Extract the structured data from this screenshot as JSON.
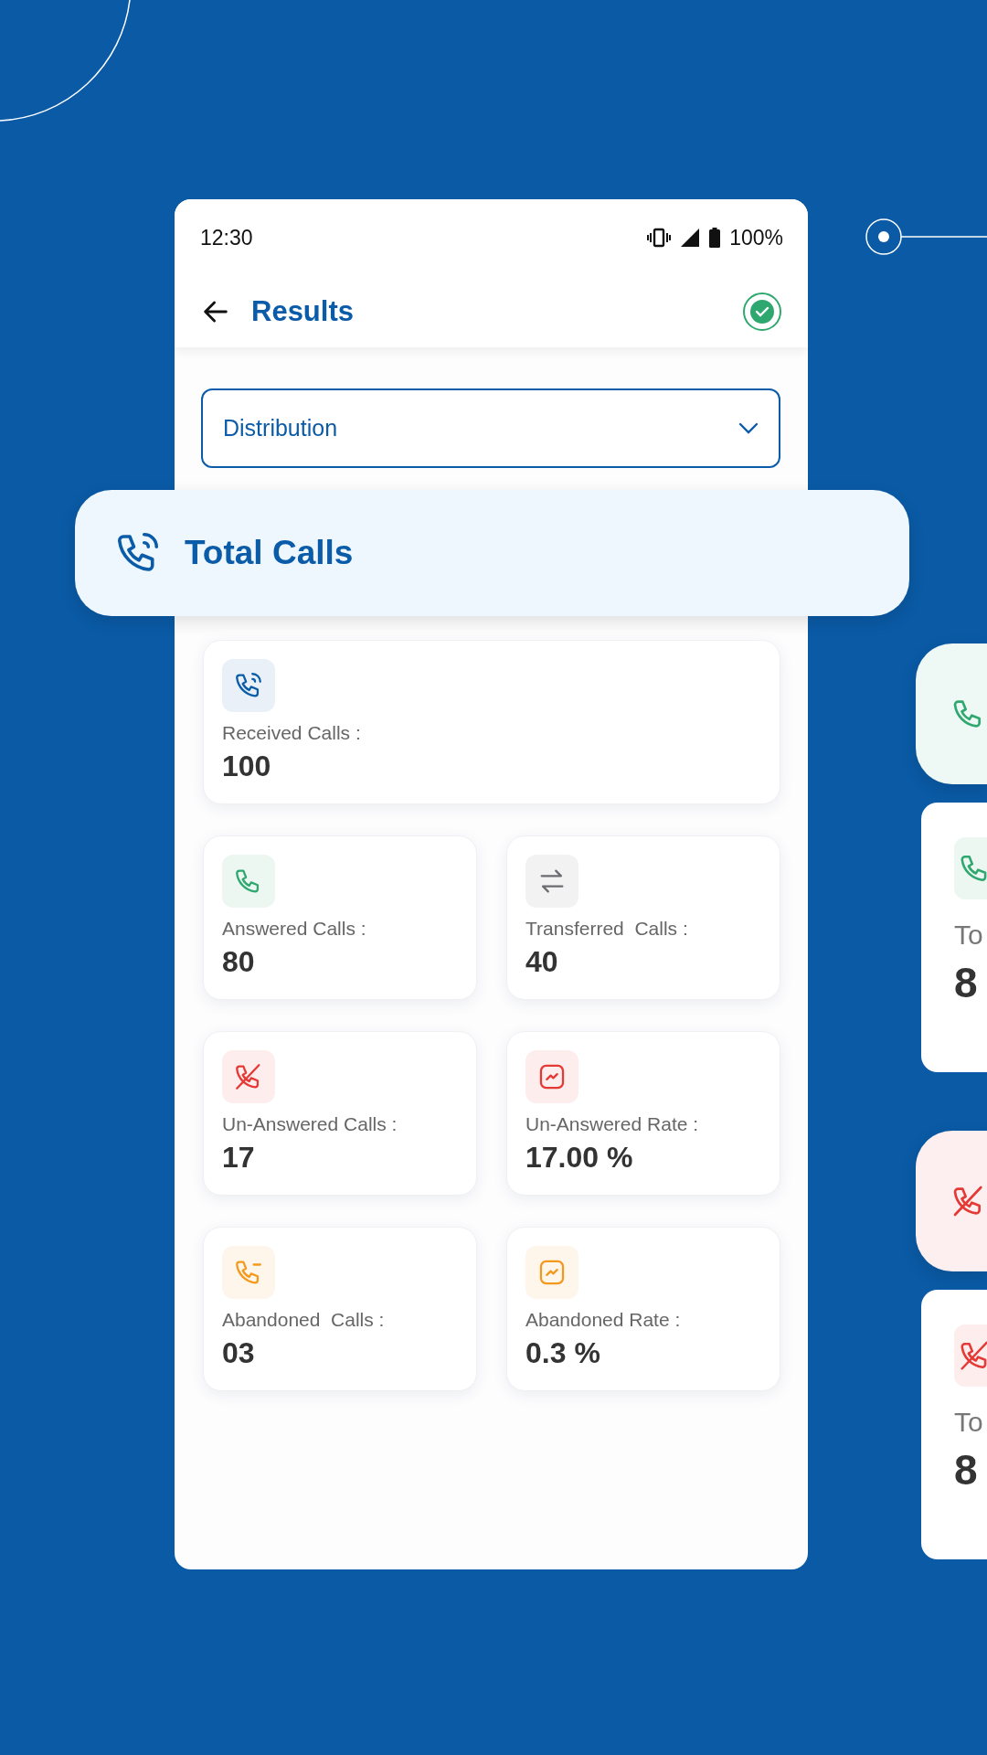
{
  "status_bar": {
    "time": "12:30",
    "battery": "100%"
  },
  "header": {
    "title": "Results",
    "verified": true
  },
  "dropdown": {
    "value": "Distribution"
  },
  "banner": {
    "title": "Total Calls"
  },
  "cards": [
    {
      "kind": "phone-wave",
      "color": "#0b5ca8",
      "label": "Received Calls :",
      "value": "100",
      "wide": true
    },
    {
      "kind": "phone",
      "color": "#2fa870",
      "label": "Answered Calls :",
      "value": "80",
      "wide": false
    },
    {
      "kind": "transfer",
      "color": "#6b6b70",
      "label": "Transferred  Calls :",
      "value": "40",
      "wide": false
    },
    {
      "kind": "phone-off",
      "color": "#e53935",
      "label": "Un-Answered Calls :",
      "value": "17",
      "wide": false
    },
    {
      "kind": "chart",
      "color": "#e53935",
      "label": "Un-Answered Rate :",
      "value": "17.00 %",
      "wide": false
    },
    {
      "kind": "phone-minus",
      "color": "#f39a1e",
      "label": "Abandoned  Calls :",
      "value": "03",
      "wide": false
    },
    {
      "kind": "chart",
      "color": "#f39a1e",
      "label": "Abandoned Rate :",
      "value": "0.3 %",
      "wide": false
    }
  ],
  "side_cards": [
    {
      "kind": "tile",
      "color": "#2fa870"
    },
    {
      "kind": "stat",
      "color": "#2fa870",
      "label": "To",
      "value": "8"
    },
    {
      "kind": "tile",
      "color": "#e53935"
    },
    {
      "kind": "stat",
      "color": "#e53935",
      "label": "To",
      "value": "8"
    }
  ]
}
